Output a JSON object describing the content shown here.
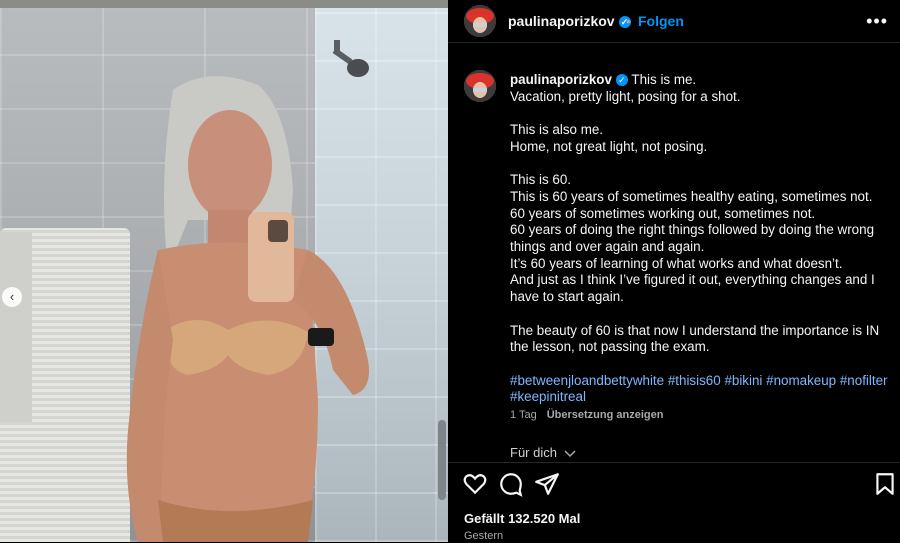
{
  "header": {
    "username": "paulinaporizkov",
    "separator": "•",
    "follow_label": "Folgen",
    "more_label": "•••"
  },
  "caption": {
    "username": "paulinaporizkov",
    "lines": [
      "This is me.",
      "Vacation, pretty light, posing for a shot.",
      "",
      "This is also me.",
      "Home, not great light, not posing.",
      "",
      "This is 60.",
      "This is 60 years of sometimes healthy eating, sometimes not.",
      "60 years of sometimes working out, sometimes not.",
      "60 years of doing the right things followed by doing the wrong things and over again and again.",
      "It’s 60 years of learning of what works and what doesn’t.",
      "And just as I think I’ve figured it out, everything changes and I have to start again.",
      "",
      "The beauty of 60 is that now I understand the importance is IN the lesson, not passing the exam."
    ],
    "hashtags": [
      "#betweenjloandbettywhite",
      "#thisis60",
      "#bikini",
      "#nomakeup",
      "#nofilter",
      "#keepinitreal"
    ],
    "time_ago": "1 Tag",
    "translate_label": "Übersetzung anzeigen"
  },
  "for_you": {
    "label": "Für dich",
    "chevron_icon": "chevron-down-icon"
  },
  "media": {
    "prev_icon": "‹"
  },
  "actions": {
    "likes": "Gefällt 132.520 Mal",
    "date": "Gestern"
  },
  "colors": {
    "accent": "#0095f6",
    "hashtag": "#7fb7ff",
    "background": "#000000"
  }
}
